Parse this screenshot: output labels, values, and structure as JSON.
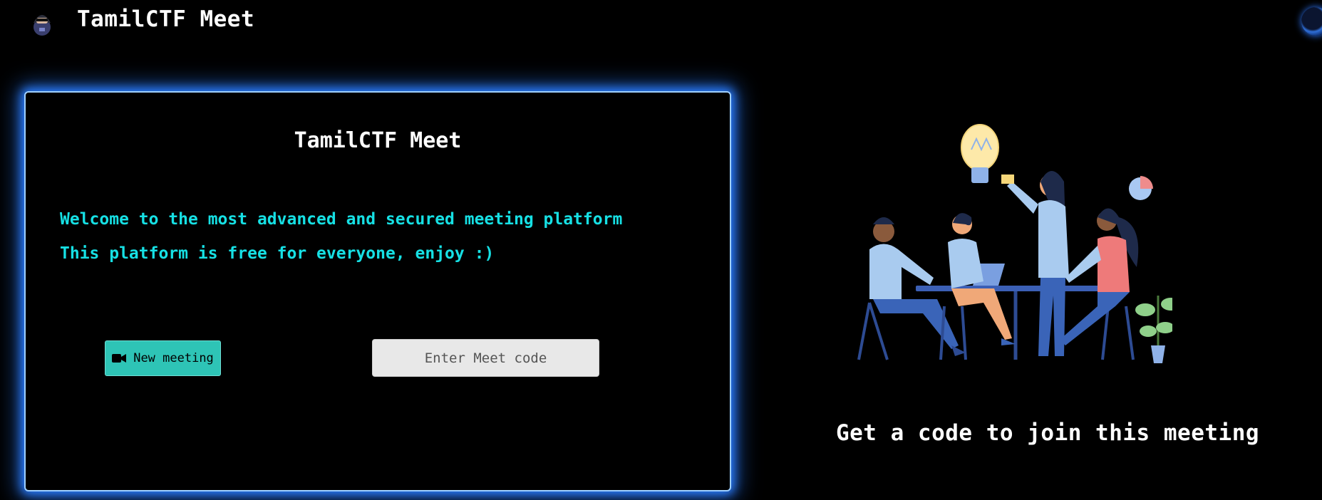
{
  "header": {
    "app_title": "TamilCTF Meet",
    "logo_icon": "hacker-avatar-icon",
    "account_icon": "account-avatar-icon"
  },
  "card": {
    "title": "TamilCTF Meet",
    "welcome_lines": [
      "Welcome to the most advanced and secured meeting platform",
      "This platform is free for everyone, enjoy :)"
    ],
    "new_meeting_label": "New meeting",
    "new_meeting_icon": "video-camera-icon",
    "meet_code_placeholder": "Enter Meet code",
    "meet_code_value": ""
  },
  "hero": {
    "illustration": "team-meeting-illustration",
    "caption": "Get a code to join this meeting"
  },
  "colors": {
    "background": "#000000",
    "accent_cyan": "#16e0e4",
    "button_teal": "#2ec4b6",
    "card_glow": "#2b7dff"
  }
}
